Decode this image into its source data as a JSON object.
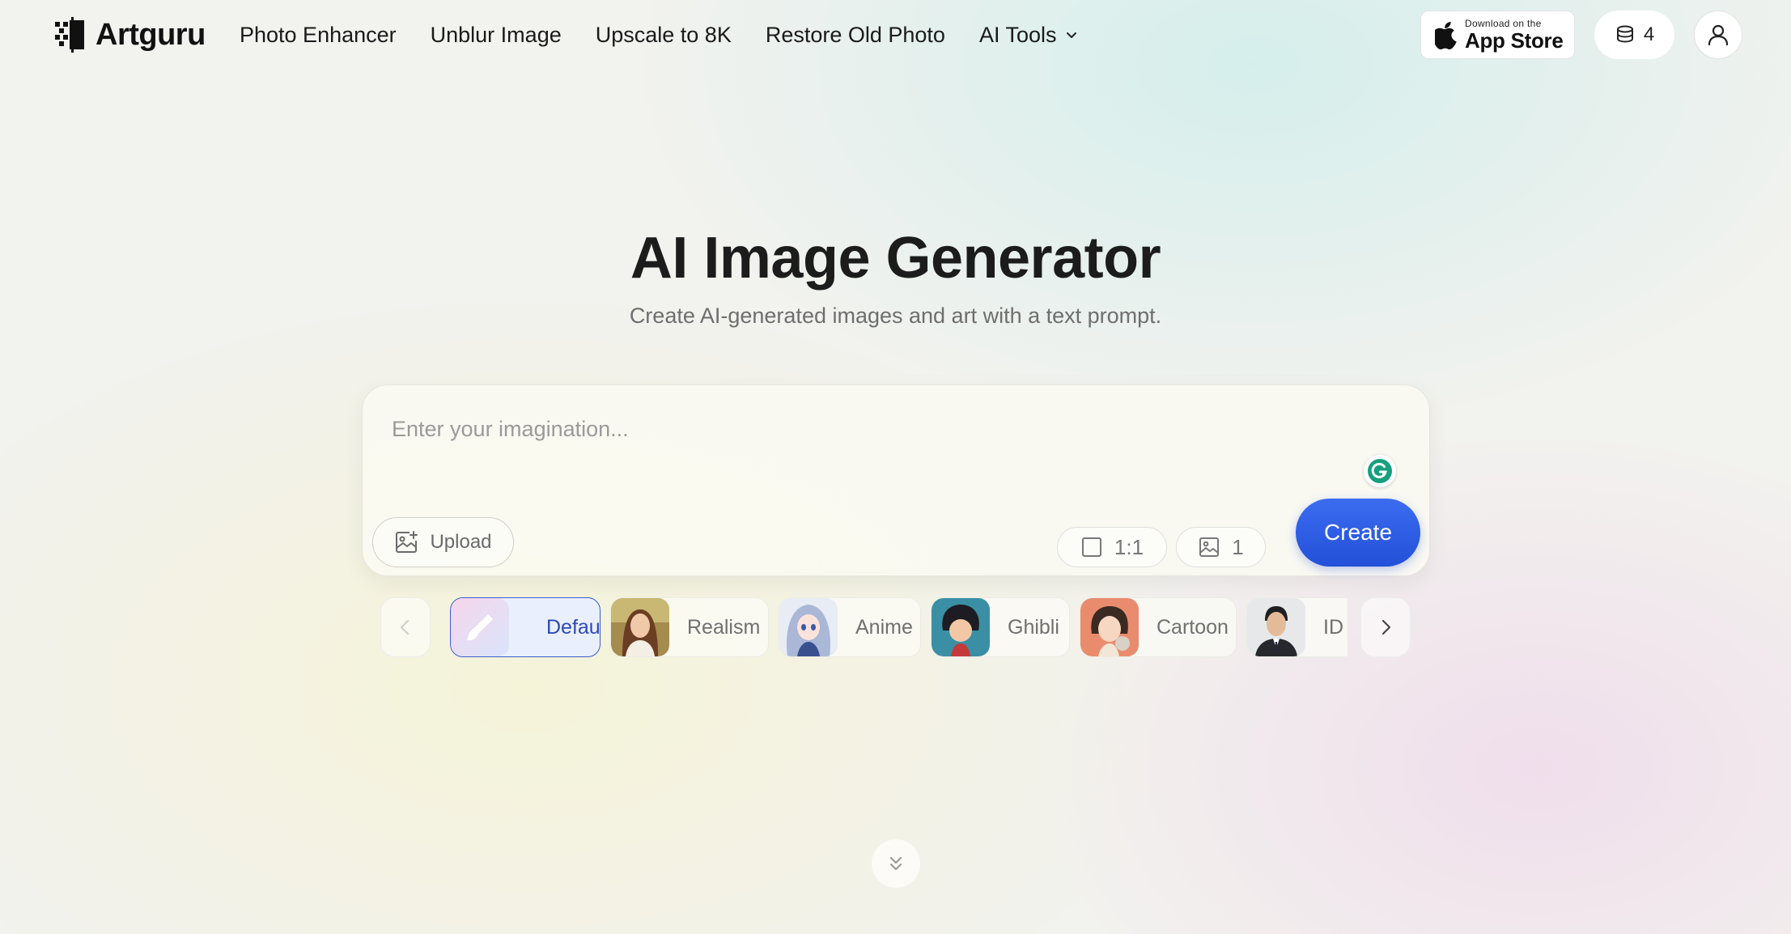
{
  "brand": {
    "name": "Artguru"
  },
  "nav": {
    "items": [
      "Photo Enhancer",
      "Unblur Image",
      "Upscale to 8K",
      "Restore Old Photo"
    ],
    "dropdown_label": "AI Tools"
  },
  "appstore": {
    "small_text": "Download on the",
    "big_text": "App Store"
  },
  "credits": {
    "count": "4"
  },
  "hero": {
    "title": "AI Image Generator",
    "subtitle": "Create AI-generated images and art with a text prompt."
  },
  "prompt": {
    "placeholder": "Enter your imagination...",
    "upload_label": "Upload",
    "ratio_value": "1:1",
    "count_value": "1",
    "create_label": "Create"
  },
  "styles": {
    "items": [
      {
        "label": "Default",
        "selected": true
      },
      {
        "label": "Realism",
        "selected": false
      },
      {
        "label": "Anime",
        "selected": false
      },
      {
        "label": "Ghibli",
        "selected": false
      },
      {
        "label": "Cartoon",
        "selected": false
      },
      {
        "label": "ID",
        "selected": false
      }
    ]
  },
  "colors": {
    "accent": "#2350d8",
    "selected_chip_bg": "#e9effd",
    "selected_chip_border": "#3a5bd0"
  }
}
